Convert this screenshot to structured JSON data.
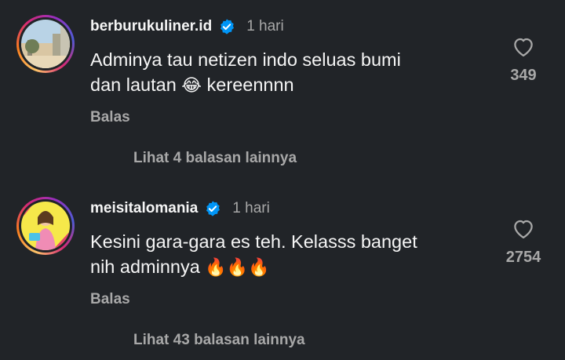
{
  "comments": [
    {
      "username": "berburukuliner.id",
      "time": "1 hari",
      "text_line1": "Adminya tau netizen indo seluas bumi",
      "text_line2_prefix": "dan lautan ",
      "text_line2_emoji": "😂",
      "text_line2_suffix": " kereennnn",
      "reply_label": "Balas",
      "more_replies": "Lihat 4 balasan lainnya",
      "like_count": "349",
      "avatar_icon": "cityscape-avatar-icon"
    },
    {
      "username": "meisitalomania",
      "time": "1 hari",
      "text_line1": "Kesini gara-gara es teh. Kelasss banget",
      "text_line2_prefix": "nih adminnya ",
      "text_line2_emoji": "🔥🔥🔥",
      "text_line2_suffix": "",
      "reply_label": "Balas",
      "more_replies": "Lihat 43 balasan lainnya",
      "like_count": "2754",
      "avatar_icon": "person-avatar-icon"
    }
  ],
  "colors": {
    "background": "#212428",
    "primary_text": "#f5f5f5",
    "secondary_text": "#a8a8a8",
    "verified_blue": "#0095f6"
  }
}
